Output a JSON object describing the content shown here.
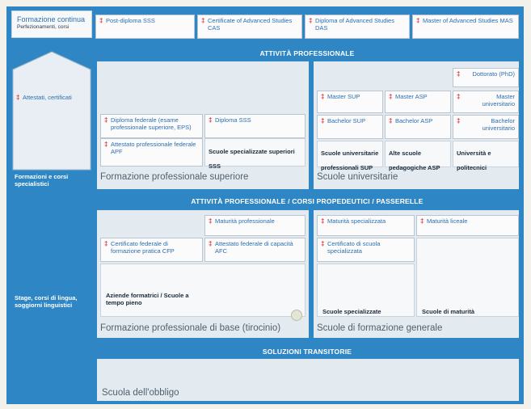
{
  "sidebar": {
    "formazione_continua": "Formazione continua",
    "perfezionamenti": "Perfezionamenti, corsi",
    "attestati": "Attestati, certificati",
    "formazioni_corsi": "Formazioni e corsi specialistici",
    "stage": "Stage, corsi di lingua, soggiorni linguistici"
  },
  "top_row": [
    {
      "label": "Post-diploma SSS"
    },
    {
      "label": "Certificate of Advanced Studies CAS"
    },
    {
      "label": "Diploma of Advanced Studies DAS"
    },
    {
      "label": "Master of Advanced Studies MAS"
    }
  ],
  "bands": {
    "attivita": "ATTIVITÀ PROFESSIONALE",
    "attivita_corsi": "ATTIVITÀ PROFESSIONALE / CORSI PROPEDEUTICI / PASSERELLE",
    "soluzioni": "SOLUZIONI TRANSITORIE"
  },
  "superiore": {
    "title": "Formazione professionale superiore",
    "esame": "Diploma federale (esame professionale superiore, EPS)",
    "diploma_sss": "Diploma SSS",
    "attestato_apf": "Attestato professionale federale APF",
    "scuole_sss": "Scuole specializzate superiori SSS"
  },
  "universitarie": {
    "title": "Scuole universitarie",
    "dottorato": "Dottorato (PhD)",
    "master_sup": "Master SUP",
    "master_asp": "Master ASP",
    "master_uni": "Master universitario",
    "bachelor_sup": "Bachelor SUP",
    "bachelor_asp": "Bachelor ASP",
    "bachelor_uni": "Bachelor universitario",
    "col_sup": "Scuole universitarie professionali SUP",
    "col_asp": "Alte scuole pedagogiche ASP",
    "col_uni": "Università e politecnici"
  },
  "base": {
    "title": "Formazione professionale di base (tirocinio)",
    "maturita_prof": "Maturità professionale",
    "cfp": "Certificato federale di formazione pratica CFP",
    "afc": "Attestato federale di capacità AFC",
    "aziende": "Aziende formatrici / Scuole a tempo pieno"
  },
  "generale": {
    "title": "Scuole di formazione generale",
    "maturita_spec": "Maturità specializzata",
    "maturita_liceale": "Maturità liceale",
    "cert_spec": "Certificato di scuola specializzata",
    "scuole_spec": "Scuole specializzate",
    "scuole_mat": "Scuole di maturità"
  },
  "obbligo": {
    "title": "Scuola dell'obbligo"
  },
  "marker": "‡",
  "colors": {
    "frame": "#2f86c4",
    "marker": "#d9262c",
    "cell_text": "#2b6fb0"
  }
}
